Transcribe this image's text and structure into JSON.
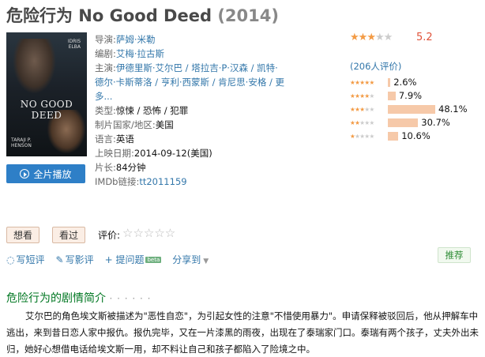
{
  "header": {
    "title": "危险行为 No Good Deed",
    "year": "(2014)"
  },
  "poster": {
    "actor_top": "IDRIS",
    "actor_top2": "ELBA",
    "title_text": "NO GOOD DEED",
    "actor_bottom": "TARAJI P.",
    "actor_bottom2": "HENSON"
  },
  "play_button": {
    "label": "全片播放",
    "icon": "play-circle-icon"
  },
  "info": {
    "director_label": "导演:",
    "director": "萨姆·米勒",
    "writer_label": "编剧:",
    "writer": "艾梅·拉古斯",
    "cast_label": "主演:",
    "cast_line1": "伊德里斯·艾尔巴 / 塔拉吉·P·汉森 / 凯特·",
    "cast_line2": "德尔·卡斯蒂洛 / 亨利·西蒙斯 / 肯尼思·安格 / 更",
    "cast_line3": "多...",
    "genre_label": "类型:",
    "genre": "惊悚 / 恐怖 / 犯罪",
    "country_label": "制片国家/地区:",
    "country": "美国",
    "language_label": "语言:",
    "language": "英语",
    "release_label": "上映日期:",
    "release": "2014-09-12(美国)",
    "runtime_label": "片长:",
    "runtime": "84分钟",
    "imdb_label": "IMDb链接:",
    "imdb": "tt2011159"
  },
  "rating": {
    "score": "5.2",
    "stars_filled": 3,
    "stars_total": 5,
    "reviews": "(206人评价)",
    "distribution": [
      {
        "stars": 5,
        "pct": "2.6%",
        "value": 2.6
      },
      {
        "stars": 4,
        "pct": "7.9%",
        "value": 7.9
      },
      {
        "stars": 3,
        "pct": "48.1%",
        "value": 48.1
      },
      {
        "stars": 2,
        "pct": "30.7%",
        "value": 30.7
      },
      {
        "stars": 1,
        "pct": "10.6%",
        "value": 10.6
      }
    ]
  },
  "user_actions": {
    "want": "想看",
    "seen": "看过",
    "rate_label": "评价:",
    "rate_stars": "☆☆☆☆☆"
  },
  "links": {
    "write_review": "写短评",
    "write_long": "写影评",
    "ask": "+ 提问题",
    "beta": "beta",
    "share": "分享到",
    "recommend": "推荐"
  },
  "synopsis": {
    "heading": "危险行为的剧情简介",
    "dots": "· · · · · ·",
    "text": "艾尔巴的角色埃文斯被描述为\"恶性自恋\"，为引起女性的注意\"不惜使用暴力\"。申请保释被驳回后，他从押解车中逃出，来到昔日恋人家中报仇。报仇完毕，又在一片漆黑的雨夜，出现在了泰瑞家门口。泰瑞有两个孩子，丈夫外出未归，她好心想借电话给埃文斯一用，却不料让自己和孩子都陷入了险境之中。"
  },
  "colors": {
    "link": "#3377aa",
    "star": "#f39b45",
    "score": "#e0533b",
    "bar": "#f6c9a9",
    "heading_green": "#007722",
    "play_button": "#2e7fc7"
  }
}
